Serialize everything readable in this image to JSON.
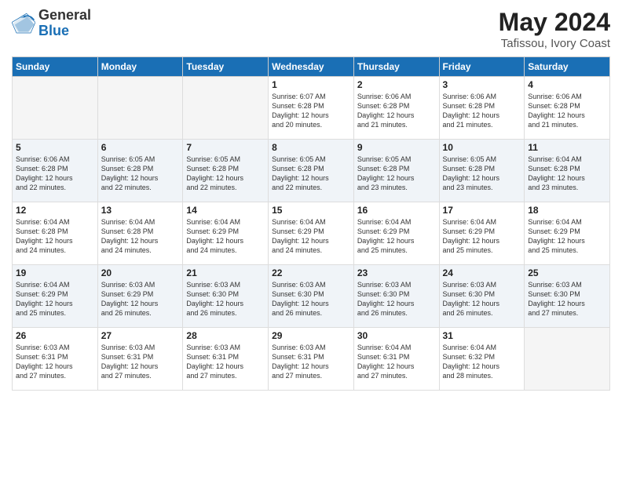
{
  "logo": {
    "general": "General",
    "blue": "Blue"
  },
  "title": "May 2024",
  "location": "Tafissou, Ivory Coast",
  "weekdays": [
    "Sunday",
    "Monday",
    "Tuesday",
    "Wednesday",
    "Thursday",
    "Friday",
    "Saturday"
  ],
  "weeks": [
    [
      {
        "day": "",
        "info": ""
      },
      {
        "day": "",
        "info": ""
      },
      {
        "day": "",
        "info": ""
      },
      {
        "day": "1",
        "info": "Sunrise: 6:07 AM\nSunset: 6:28 PM\nDaylight: 12 hours\nand 20 minutes."
      },
      {
        "day": "2",
        "info": "Sunrise: 6:06 AM\nSunset: 6:28 PM\nDaylight: 12 hours\nand 21 minutes."
      },
      {
        "day": "3",
        "info": "Sunrise: 6:06 AM\nSunset: 6:28 PM\nDaylight: 12 hours\nand 21 minutes."
      },
      {
        "day": "4",
        "info": "Sunrise: 6:06 AM\nSunset: 6:28 PM\nDaylight: 12 hours\nand 21 minutes."
      }
    ],
    [
      {
        "day": "5",
        "info": "Sunrise: 6:06 AM\nSunset: 6:28 PM\nDaylight: 12 hours\nand 22 minutes."
      },
      {
        "day": "6",
        "info": "Sunrise: 6:05 AM\nSunset: 6:28 PM\nDaylight: 12 hours\nand 22 minutes."
      },
      {
        "day": "7",
        "info": "Sunrise: 6:05 AM\nSunset: 6:28 PM\nDaylight: 12 hours\nand 22 minutes."
      },
      {
        "day": "8",
        "info": "Sunrise: 6:05 AM\nSunset: 6:28 PM\nDaylight: 12 hours\nand 22 minutes."
      },
      {
        "day": "9",
        "info": "Sunrise: 6:05 AM\nSunset: 6:28 PM\nDaylight: 12 hours\nand 23 minutes."
      },
      {
        "day": "10",
        "info": "Sunrise: 6:05 AM\nSunset: 6:28 PM\nDaylight: 12 hours\nand 23 minutes."
      },
      {
        "day": "11",
        "info": "Sunrise: 6:04 AM\nSunset: 6:28 PM\nDaylight: 12 hours\nand 23 minutes."
      }
    ],
    [
      {
        "day": "12",
        "info": "Sunrise: 6:04 AM\nSunset: 6:28 PM\nDaylight: 12 hours\nand 24 minutes."
      },
      {
        "day": "13",
        "info": "Sunrise: 6:04 AM\nSunset: 6:28 PM\nDaylight: 12 hours\nand 24 minutes."
      },
      {
        "day": "14",
        "info": "Sunrise: 6:04 AM\nSunset: 6:29 PM\nDaylight: 12 hours\nand 24 minutes."
      },
      {
        "day": "15",
        "info": "Sunrise: 6:04 AM\nSunset: 6:29 PM\nDaylight: 12 hours\nand 24 minutes."
      },
      {
        "day": "16",
        "info": "Sunrise: 6:04 AM\nSunset: 6:29 PM\nDaylight: 12 hours\nand 25 minutes."
      },
      {
        "day": "17",
        "info": "Sunrise: 6:04 AM\nSunset: 6:29 PM\nDaylight: 12 hours\nand 25 minutes."
      },
      {
        "day": "18",
        "info": "Sunrise: 6:04 AM\nSunset: 6:29 PM\nDaylight: 12 hours\nand 25 minutes."
      }
    ],
    [
      {
        "day": "19",
        "info": "Sunrise: 6:04 AM\nSunset: 6:29 PM\nDaylight: 12 hours\nand 25 minutes."
      },
      {
        "day": "20",
        "info": "Sunrise: 6:03 AM\nSunset: 6:29 PM\nDaylight: 12 hours\nand 26 minutes."
      },
      {
        "day": "21",
        "info": "Sunrise: 6:03 AM\nSunset: 6:30 PM\nDaylight: 12 hours\nand 26 minutes."
      },
      {
        "day": "22",
        "info": "Sunrise: 6:03 AM\nSunset: 6:30 PM\nDaylight: 12 hours\nand 26 minutes."
      },
      {
        "day": "23",
        "info": "Sunrise: 6:03 AM\nSunset: 6:30 PM\nDaylight: 12 hours\nand 26 minutes."
      },
      {
        "day": "24",
        "info": "Sunrise: 6:03 AM\nSunset: 6:30 PM\nDaylight: 12 hours\nand 26 minutes."
      },
      {
        "day": "25",
        "info": "Sunrise: 6:03 AM\nSunset: 6:30 PM\nDaylight: 12 hours\nand 27 minutes."
      }
    ],
    [
      {
        "day": "26",
        "info": "Sunrise: 6:03 AM\nSunset: 6:31 PM\nDaylight: 12 hours\nand 27 minutes."
      },
      {
        "day": "27",
        "info": "Sunrise: 6:03 AM\nSunset: 6:31 PM\nDaylight: 12 hours\nand 27 minutes."
      },
      {
        "day": "28",
        "info": "Sunrise: 6:03 AM\nSunset: 6:31 PM\nDaylight: 12 hours\nand 27 minutes."
      },
      {
        "day": "29",
        "info": "Sunrise: 6:03 AM\nSunset: 6:31 PM\nDaylight: 12 hours\nand 27 minutes."
      },
      {
        "day": "30",
        "info": "Sunrise: 6:04 AM\nSunset: 6:31 PM\nDaylight: 12 hours\nand 27 minutes."
      },
      {
        "day": "31",
        "info": "Sunrise: 6:04 AM\nSunset: 6:32 PM\nDaylight: 12 hours\nand 28 minutes."
      },
      {
        "day": "",
        "info": ""
      }
    ]
  ]
}
